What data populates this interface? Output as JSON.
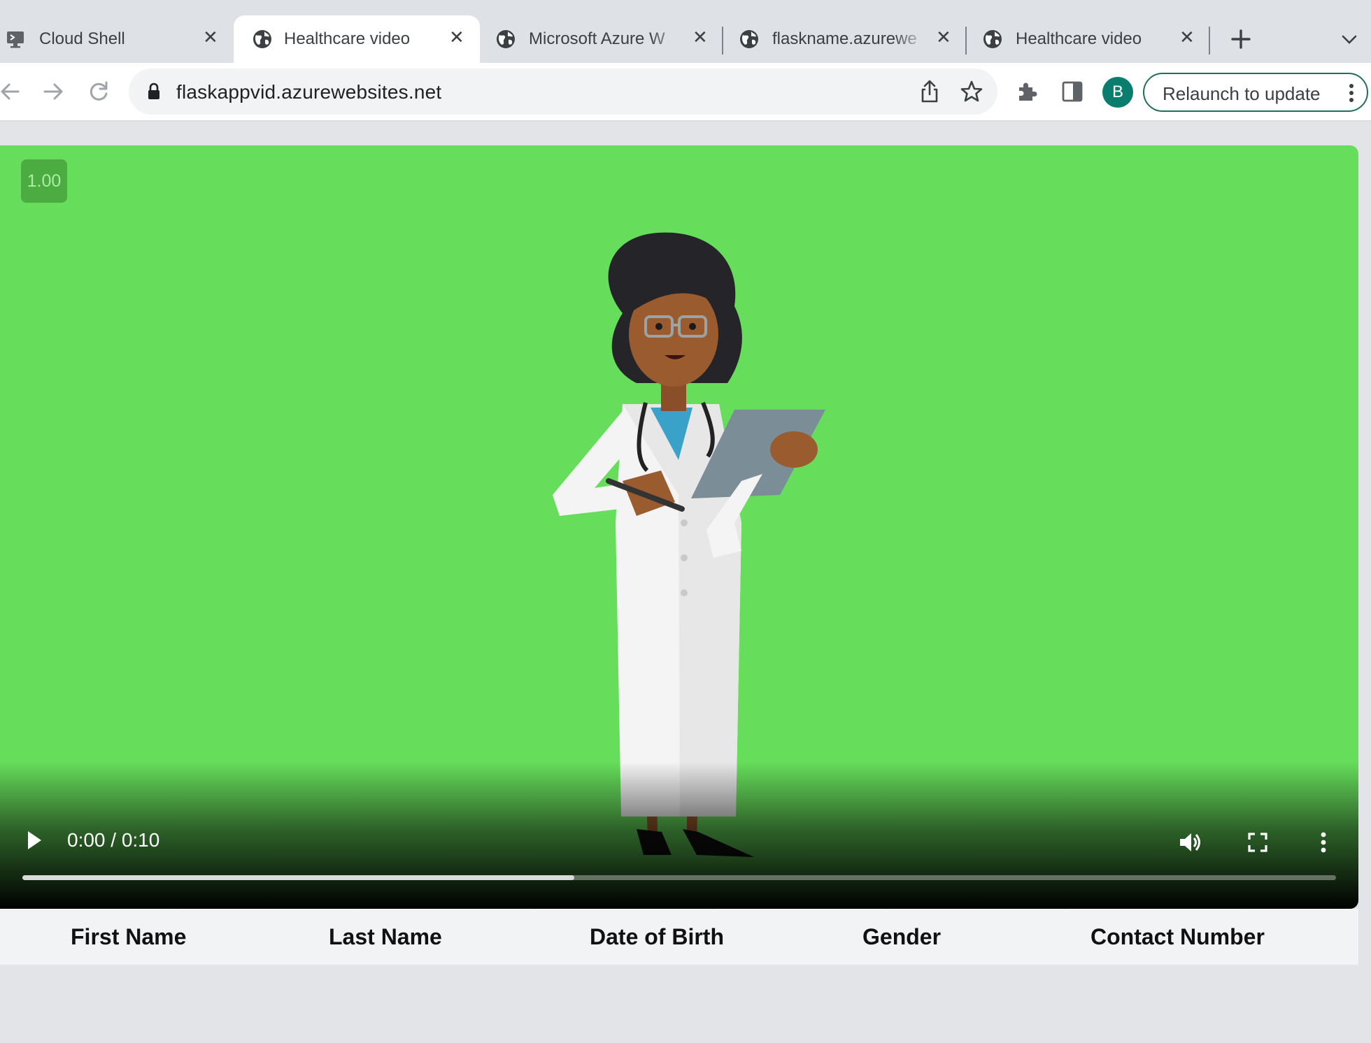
{
  "browser": {
    "tabs": [
      {
        "title": "Cloud Shell",
        "favicon": "cloud-shell-icon",
        "active": false
      },
      {
        "title": "Healthcare video",
        "favicon": "globe-icon",
        "active": true
      },
      {
        "title": "Microsoft Azure W",
        "favicon": "globe-icon",
        "active": false
      },
      {
        "title": "flaskname.azurewe",
        "favicon": "globe-icon",
        "active": false
      },
      {
        "title": "Healthcare video",
        "favicon": "globe-icon",
        "active": false
      }
    ],
    "new_tab_icon": "plus-icon",
    "tab_list_icon": "chevron-down-icon",
    "url": "flaskappvid.azurewebsites.net",
    "profile_initial": "B",
    "relaunch_label": "Relaunch to update"
  },
  "colors": {
    "video_background": "#66dd5b",
    "relaunch_border": "#1e6f5c",
    "avatar": "#0b7d6e"
  },
  "video": {
    "speed": "1.00",
    "time_display": "0:00 / 0:10",
    "current_time": "0:00",
    "duration": "0:10",
    "buffered_fraction": 0.42,
    "subject": "doctor-illustration"
  },
  "table": {
    "headers": [
      "First Name",
      "Last Name",
      "Date of Birth",
      "Gender",
      "Contact Number"
    ]
  }
}
